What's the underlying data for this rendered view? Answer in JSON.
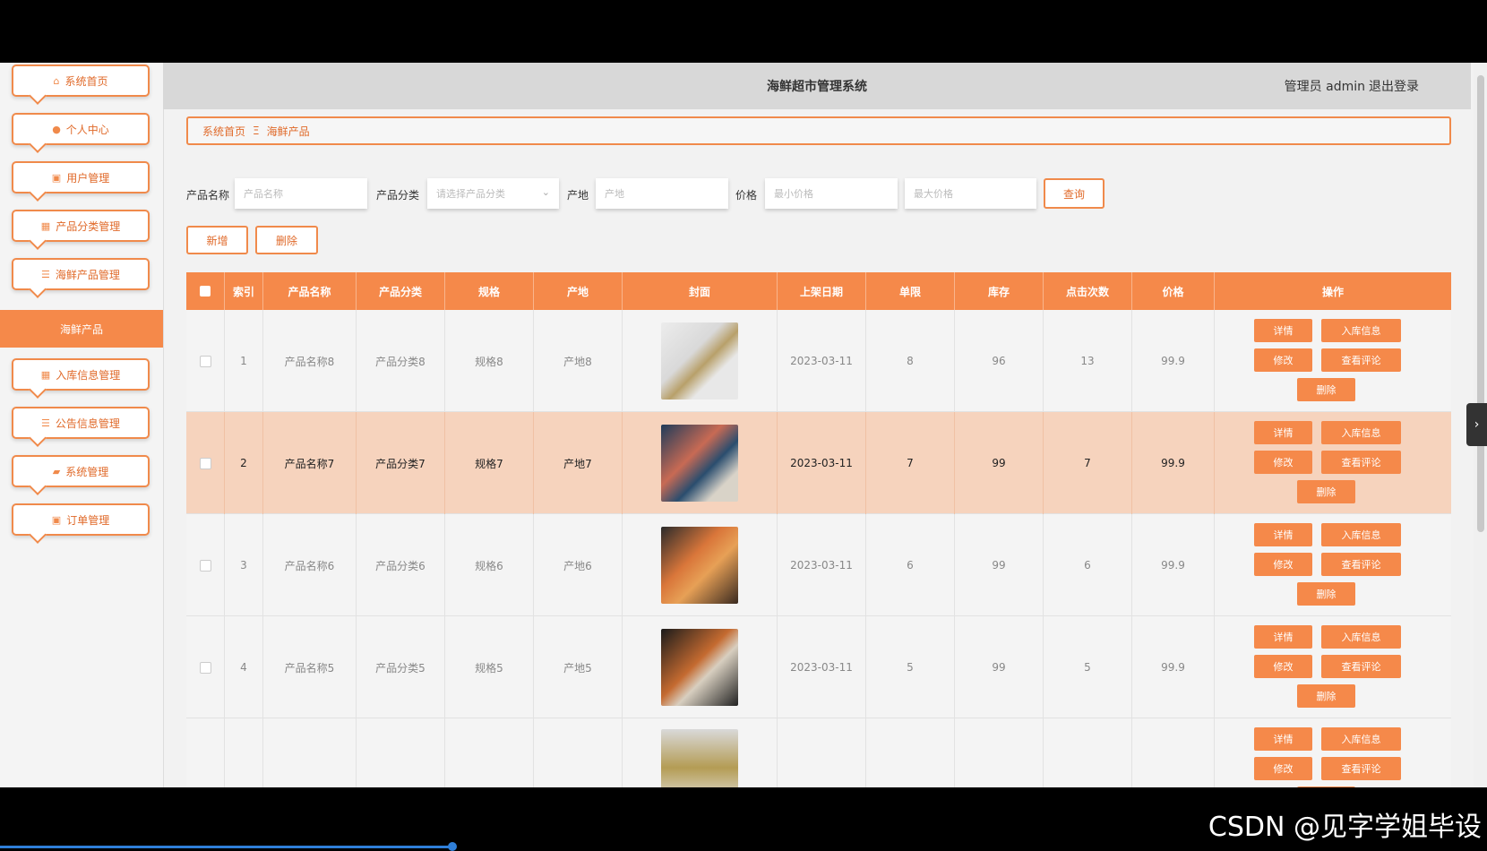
{
  "header": {
    "title": "海鲜超市管理系统",
    "user": "管理员 admin",
    "logout": "退出登录"
  },
  "sidebar": {
    "items": [
      {
        "label": "系统首页",
        "icon": "home-icon"
      },
      {
        "label": "个人中心",
        "icon": "user-icon"
      },
      {
        "label": "用户管理",
        "icon": "clipboard-icon"
      },
      {
        "label": "产品分类管理",
        "icon": "grid-icon"
      },
      {
        "label": "海鲜产品管理",
        "icon": "sliders-icon"
      }
    ],
    "active": "海鲜产品",
    "items2": [
      {
        "label": "入库信息管理",
        "icon": "grid-icon"
      },
      {
        "label": "公告信息管理",
        "icon": "list-icon"
      },
      {
        "label": "系统管理",
        "icon": "briefcase-icon"
      },
      {
        "label": "订单管理",
        "icon": "clipboard-icon"
      }
    ]
  },
  "breadcrumb": {
    "home": "系统首页",
    "sep": "Ξ",
    "current": "海鲜产品"
  },
  "search": {
    "name_label": "产品名称",
    "name_placeholder": "产品名称",
    "category_label": "产品分类",
    "category_placeholder": "请选择产品分类",
    "origin_label": "产地",
    "origin_placeholder": "产地",
    "price_label": "价格",
    "min_placeholder": "最小价格",
    "max_placeholder": "最大价格",
    "query": "查询"
  },
  "actions": {
    "add": "新增",
    "delete": "删除"
  },
  "table": {
    "headers": [
      "索引",
      "产品名称",
      "产品分类",
      "规格",
      "产地",
      "封面",
      "上架日期",
      "单限",
      "库存",
      "点击次数",
      "价格",
      "操作"
    ],
    "rows": [
      {
        "index": "1",
        "name": "产品名称8",
        "category": "产品分类8",
        "spec": "规格8",
        "origin": "产地8",
        "date": "2023-03-11",
        "limit": "8",
        "stock": "96",
        "clicks": "13",
        "price": "99.9"
      },
      {
        "index": "2",
        "name": "产品名称7",
        "category": "产品分类7",
        "spec": "规格7",
        "origin": "产地7",
        "date": "2023-03-11",
        "limit": "7",
        "stock": "99",
        "clicks": "7",
        "price": "99.9"
      },
      {
        "index": "3",
        "name": "产品名称6",
        "category": "产品分类6",
        "spec": "规格6",
        "origin": "产地6",
        "date": "2023-03-11",
        "limit": "6",
        "stock": "99",
        "clicks": "6",
        "price": "99.9"
      },
      {
        "index": "4",
        "name": "产品名称5",
        "category": "产品分类5",
        "spec": "规格5",
        "origin": "产地5",
        "date": "2023-03-11",
        "limit": "5",
        "stock": "99",
        "clicks": "5",
        "price": "99.9"
      },
      {
        "index": "",
        "name": "",
        "category": "",
        "spec": "",
        "origin": "",
        "date": "",
        "limit": "",
        "stock": "",
        "clicks": "",
        "price": ""
      }
    ],
    "ops": {
      "detail": "详情",
      "stock_in": "入库信息",
      "edit": "修改",
      "comments": "查看评论",
      "delete": "删除"
    }
  },
  "watermark": "CSDN @见字学姐毕设",
  "colors": {
    "accent": "#f5894a",
    "highlight_row": "#f6d3bd"
  }
}
